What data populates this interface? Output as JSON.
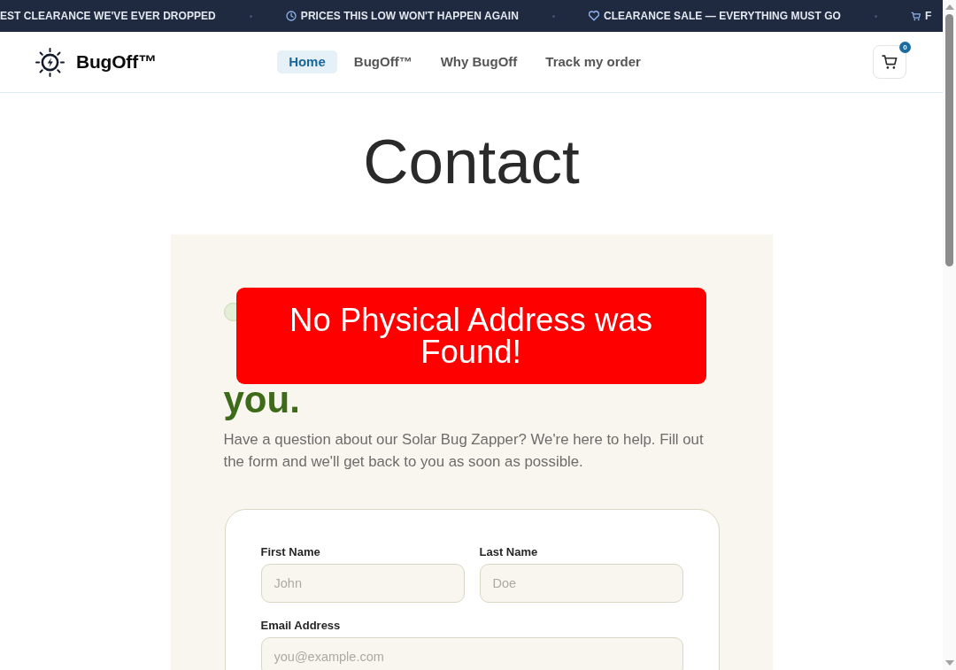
{
  "announcement_bar": {
    "items": [
      "EST CLEARANCE WE'VE EVER DROPPED",
      "PRICES THIS LOW WON'T HAPPEN AGAIN",
      "CLEARANCE SALE — EVERYTHING MUST GO",
      "F"
    ]
  },
  "header": {
    "brand": "BugOff™",
    "nav": [
      {
        "label": "Home",
        "selected": true
      },
      {
        "label": "BugOff™",
        "selected": false
      },
      {
        "label": "Why BugOff",
        "selected": false
      },
      {
        "label": "Track my order",
        "selected": false
      }
    ],
    "cart_count": "0"
  },
  "page_title": "Contact",
  "contact_section": {
    "heading_accent": "you.",
    "intro": "Have a question about our Solar Bug Zapper? We're here to help. Fill out the form and we'll get back to you as soon as possible.",
    "form": {
      "rows": [
        [
          {
            "label": "First Name",
            "placeholder": "John"
          },
          {
            "label": "Last Name",
            "placeholder": "Doe"
          }
        ],
        [
          {
            "label": "Email Address",
            "placeholder": "you@example.com"
          }
        ]
      ]
    }
  },
  "alert": {
    "message": "No Physical Address was Found!"
  }
}
